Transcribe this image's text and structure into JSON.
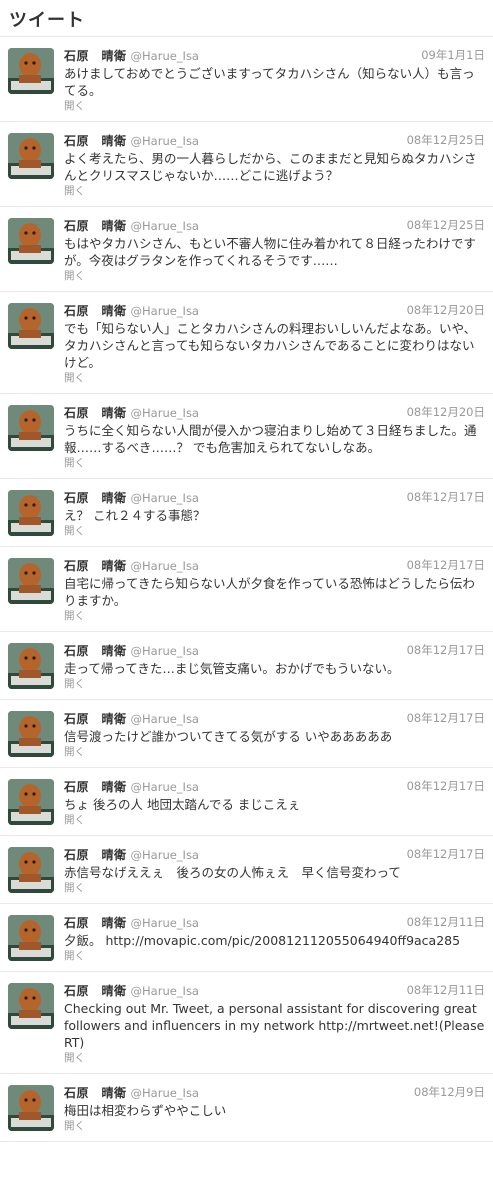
{
  "header": {
    "title": "ツイート"
  },
  "colors": {
    "text": "#333333",
    "muted": "#999999",
    "divider": "#e8e8e8"
  },
  "tweets": [
    {
      "name": "石原　晴衛",
      "screen": "@Harue_Isa",
      "time": "09年1月1日",
      "text": "あけましておめでとうございますってタカハシさん（知らない人）も言ってる。",
      "expand": "開く"
    },
    {
      "name": "石原　晴衛",
      "screen": "@Harue_Isa",
      "time": "08年12月25日",
      "text": "よく考えたら、男の一人暮らしだから、このままだと見知らぬタカハシさんとクリスマスじゃないか……どこに逃げよう？",
      "expand": "開く"
    },
    {
      "name": "石原　晴衛",
      "screen": "@Harue_Isa",
      "time": "08年12月25日",
      "text": "もはやタカハシさん、もとい不審人物に住み着かれて８日経ったわけですが。今夜はグラタンを作ってくれるそうです……",
      "expand": "開く"
    },
    {
      "name": "石原　晴衛",
      "screen": "@Harue_Isa",
      "time": "08年12月20日",
      "text": "でも「知らない人」ことタカハシさんの料理おいしいんだよなあ。いや、タカハシさんと言っても知らないタカハシさんであることに変わりはないけど。",
      "expand": "開く"
    },
    {
      "name": "石原　晴衛",
      "screen": "@Harue_Isa",
      "time": "08年12月20日",
      "text": "うちに全く知らない人間が侵入かつ寝泊まりし始めて３日経ちました。通報……するべき……？ でも危害加えられてないしなあ。",
      "expand": "開く"
    },
    {
      "name": "石原　晴衛",
      "screen": "@Harue_Isa",
      "time": "08年12月17日",
      "text": "え？ これ２４する事態？",
      "expand": "開く"
    },
    {
      "name": "石原　晴衛",
      "screen": "@Harue_Isa",
      "time": "08年12月17日",
      "text": "自宅に帰ってきたら知らない人が夕食を作っている恐怖はどうしたら伝わりますか。",
      "expand": "開く"
    },
    {
      "name": "石原　晴衛",
      "screen": "@Harue_Isa",
      "time": "08年12月17日",
      "text": "走って帰ってきた…まじ気管支痛い。おかげでもういない。",
      "expand": "開く"
    },
    {
      "name": "石原　晴衛",
      "screen": "@Harue_Isa",
      "time": "08年12月17日",
      "text": "信号渡ったけど誰かついてきてる気がする いやあああああ",
      "expand": "開く"
    },
    {
      "name": "石原　晴衛",
      "screen": "@Harue_Isa",
      "time": "08年12月17日",
      "text": "ちょ 後ろの人 地団太踏んでる まじこえぇ",
      "expand": "開く"
    },
    {
      "name": "石原　晴衛",
      "screen": "@Harue_Isa",
      "time": "08年12月17日",
      "text": "赤信号なげええぇ　後ろの女の人怖ぇえ　早く信号変わって",
      "expand": "開く"
    },
    {
      "name": "石原　晴衛",
      "screen": "@Harue_Isa",
      "time": "08年12月11日",
      "text": "夕飯。 http://movapic.com/pic/200812112055064940ff9aca285",
      "expand": "開く"
    },
    {
      "name": "石原　晴衛",
      "screen": "@Harue_Isa",
      "time": "08年12月11日",
      "text": "Checking out Mr. Tweet, a personal assistant for discovering great followers and influencers in my network  http://mrtweet.net!(Please RT)",
      "expand": "開く"
    },
    {
      "name": "石原　晴衛",
      "screen": "@Harue_Isa",
      "time": "08年12月9日",
      "text": "梅田は相変わらずややこしい",
      "expand": "開く"
    }
  ]
}
